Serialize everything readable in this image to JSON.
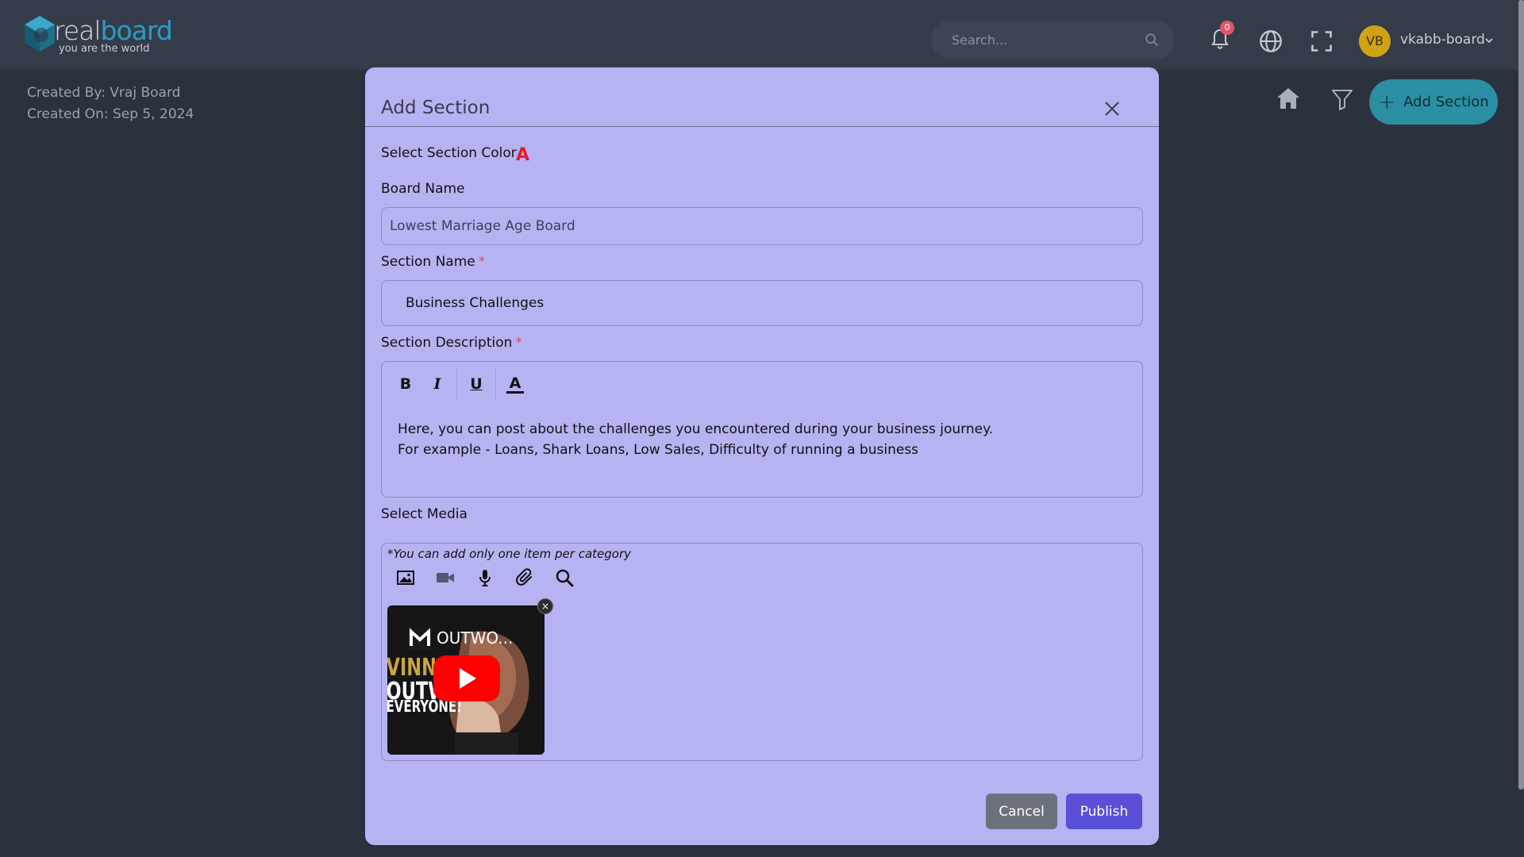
{
  "header": {
    "logo_real": "real",
    "logo_board": "board",
    "logo_tagline": "you are the world",
    "search_placeholder": "Search...",
    "notification_count": "0",
    "avatar_initials": "VB",
    "username": "vkabb-board",
    "icons": [
      "search-icon",
      "bell-icon",
      "globe-icon",
      "fullscreen-icon",
      "chevron-down-icon"
    ]
  },
  "page": {
    "created_by": "Created By: Vraj Board",
    "created_on": "Created On: Sep 5, 2024",
    "add_section_label": "Add Section",
    "icons": [
      "home-icon",
      "filter-icon",
      "plus-icon"
    ]
  },
  "modal": {
    "title": "Add Section",
    "color_label": "Select Section Color",
    "color_glyph": "A",
    "board_name_label": "Board Name",
    "board_name_value": "Lowest Marriage Age Board",
    "section_name_label": "Section Name",
    "section_name_value": "Business Challenges",
    "required_mark": "*",
    "description_label": "Section Description",
    "editor_buttons": {
      "bold": "B",
      "italic": "I",
      "underline": "U",
      "color": "A"
    },
    "description_lines": [
      "Here, you can post about the challenges you encountered during your business journey.",
      "For example - Loans, Shark Loans, Low Sales, Difficulty of running a business"
    ],
    "media_label": "Select Media",
    "media_note": "*You can add only one item per category",
    "media_tools": [
      "image-icon",
      "video-icon",
      "microphone-icon",
      "paperclip-icon",
      "search-icon"
    ],
    "thumbnail_title": "OUTWO...",
    "thumbnail_text_lines": [
      "VINNER",
      "OUTWO",
      "EVERYONE!"
    ],
    "thumbnail_close": "×",
    "cancel_label": "Cancel",
    "publish_label": "Publish"
  },
  "colors": {
    "page_bg": "#2b323e",
    "topbar_bg": "#353c49",
    "modal_bg": "#b6b3f3",
    "accent_teal": "#2a8fa2",
    "publish": "#5a4fd8",
    "cancel": "#6c727c",
    "required": "#e04c5c",
    "section_color_glyph": "#e81a2c",
    "youtube_red": "#ff0000"
  }
}
